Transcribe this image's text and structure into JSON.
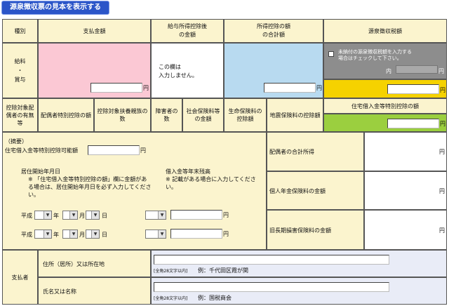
{
  "title_button": "源泉徴収票の見本を表示する",
  "header": {
    "type": "種別",
    "payment": "支払金額",
    "after_income_deduction": "給与所得控除後\nの金額",
    "deduction_total": "所得控除の額\nの合計額",
    "withholding_tax": "源泉徴収税額"
  },
  "salary_label": "給料\n・\n賞与",
  "no_input_note": "この欄は\n入力しません。",
  "unpaid_checkbox_label": "未納付の源泉徴収税額を入力する\n場合はチェックして下さい。",
  "inner_label": "内",
  "yen": "円",
  "row2": {
    "spouse_label": "控除対象配偶者の有無等",
    "spouse_special": "配偶者特別控除の額",
    "dependents": "控除対象扶養親族の数",
    "disabled": "障害者の数",
    "social_insurance": "社会保険料等の金額",
    "life_insurance": "生命保険料の控除額",
    "earthquake": "地震保険料の控除額",
    "housing_loan": "住宅借入金等特別控除の額"
  },
  "memo": {
    "label": "（摘要）",
    "housing_loan_possible": "住宅借入金等特別控除可能額",
    "residence_start_title": "居住開始年月日",
    "residence_start_note": "※ 「住宅借入金等特別控除の額」欄に金額がある場合は、居住開始年月日を必ず入力してください。",
    "loan_balance_title": "借入金等年末残高",
    "loan_balance_note": "※ 記載がある場合に入力してください。",
    "era": "平成",
    "year": "年",
    "month": "月",
    "day": "日"
  },
  "right_items": {
    "spouse_income": "配偶者の合計所得",
    "pension_insurance": "個人年金保険料の金額",
    "long_term_insurance": "旧長期損害保険料の金額"
  },
  "payer": {
    "label": "支払者",
    "address_label": "住所（居所）又は所在地",
    "address_hint_small": "[全角28文字以内]",
    "address_example": "例：千代田区霞が関",
    "name_label": "氏名又は名称",
    "name_hint_small": "[全角28文字以内]",
    "name_example": "例：国税商会"
  },
  "colors": {
    "title_button": "#2b55c8",
    "tan": "#fbf4ce",
    "pink": "#fbc8d4",
    "blue": "#b8daf0",
    "gray": "#8d8d8d",
    "yellow": "#f5d200",
    "green": "#9bcf3f"
  }
}
